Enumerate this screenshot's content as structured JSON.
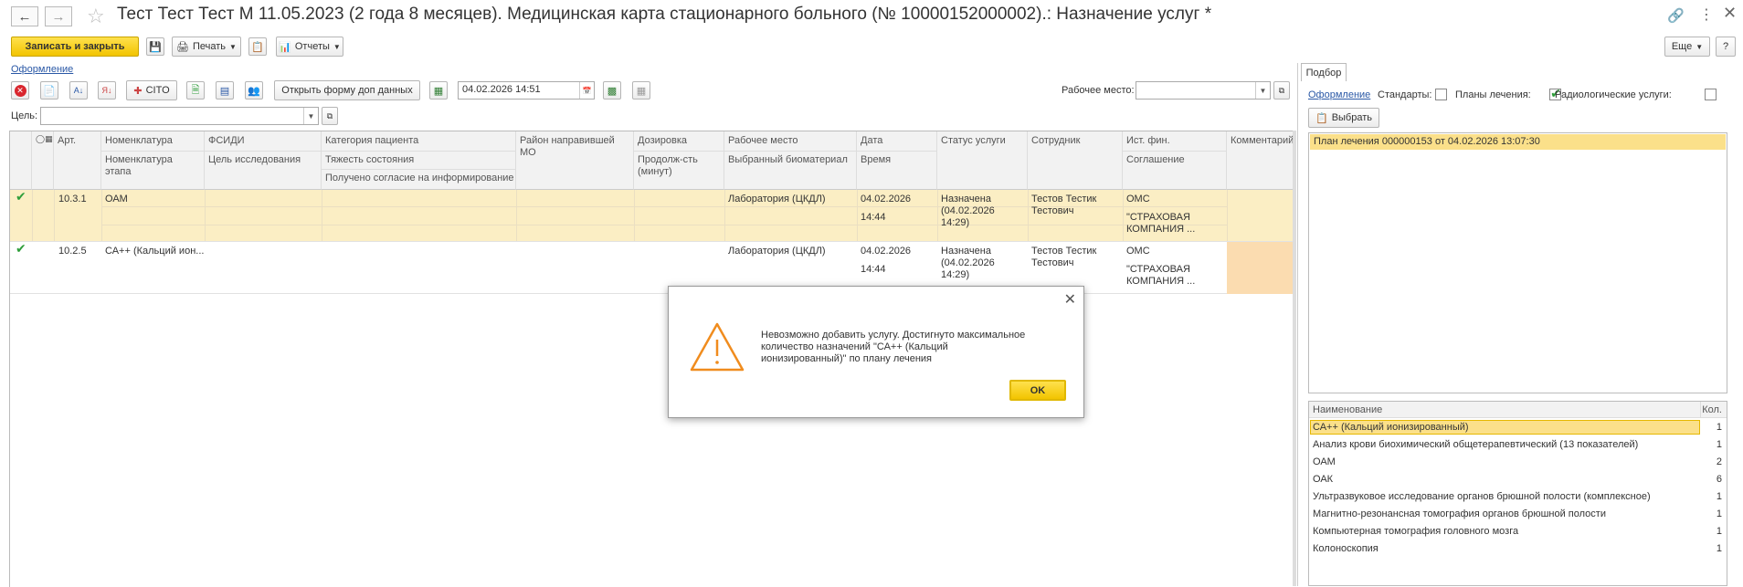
{
  "window": {
    "title": "Тест Тест Тест М 11.05.2023 (2 года 8 месяцев). Медицинская карта стационарного больного (№ 10000152000002).: Назначение услуг *"
  },
  "toolbar": {
    "save_close": "Записать и закрыть",
    "print": "Печать",
    "reports": "Отчеты",
    "more": "Еще",
    "help": "?"
  },
  "form_link": "Оформление",
  "toolbar2": {
    "cito": "CITO",
    "open_form": "Открыть форму доп данных",
    "datetime": "04.02.2026 14:51",
    "workplace_label": "Рабочее место:",
    "workplace_value": ""
  },
  "goal": {
    "label": "Цель:",
    "value": ""
  },
  "table": {
    "headers": {
      "art": "Арт.",
      "nomen": "Номенклатура",
      "nomen_stage": "Номенклатура этапа",
      "fsidi": "ФСИДИ",
      "research_goal": "Цель исследования",
      "patient_cat": "Категория пациента",
      "severity": "Тяжесть состояния",
      "consent": "Получено согласие на информирование",
      "district": "Район направившей МО",
      "dosage": "Дозировка",
      "duration": "Продолж-сть (минут)",
      "workplace": "Рабочее место",
      "biomaterial": "Выбранный биоматериал",
      "date": "Дата",
      "time": "Время",
      "status": "Статус услуги",
      "employee": "Сотрудник",
      "fin_source": "Ист. фин.",
      "agreement": "Соглашение",
      "comment": "Комментарий"
    },
    "rows": [
      {
        "art": "10.3.1",
        "nomen": "ОАМ",
        "workplace": "Лаборатория (ЦКДЛ)",
        "date": "04.02.2026",
        "time": "14:44",
        "status": "Назначена (04.02.2026 14:29)",
        "employee": "Тестов Тестик Тестович",
        "fin": "ОМС",
        "agreement": "\"СТРАХОВАЯ КОМПАНИЯ ..."
      },
      {
        "art": "10.2.5",
        "nomen": "СА++ (Кальций ион...",
        "workplace": "Лаборатория (ЦКДЛ)",
        "date": "04.02.2026",
        "time": "14:44",
        "status": "Назначена (04.02.2026 14:29)",
        "employee": "Тестов Тестик Тестович",
        "fin": "ОМС",
        "agreement": "\"СТРАХОВАЯ КОМПАНИЯ ..."
      }
    ]
  },
  "right_panel": {
    "tab": "Подбор",
    "form_link": "Оформление",
    "standards": "Стандарты:",
    "treatment_plans": "Планы лечения:",
    "radiology": "Радиологические услуги:",
    "select_button": "Выбрать",
    "plan_row": "План лечения 000000153 от 04.02.2026 13:07:30",
    "list_headers": {
      "name": "Наименование",
      "qty": "Кол."
    },
    "items": [
      {
        "name": "СА++ (Кальций ионизированный)",
        "qty": "1"
      },
      {
        "name": "Анализ крови биохимический общетерапевтический (13 показателей)",
        "qty": "1"
      },
      {
        "name": "ОАМ",
        "qty": "2"
      },
      {
        "name": "ОАК",
        "qty": "6"
      },
      {
        "name": "Ультразвуковое исследование органов брюшной полости (комплексное)",
        "qty": "1"
      },
      {
        "name": "Магнитно-резонансная томография органов брюшной полости",
        "qty": "1"
      },
      {
        "name": "Компьютерная томография головного мозга",
        "qty": "1"
      },
      {
        "name": "Колоноскопия",
        "qty": "1"
      }
    ]
  },
  "dialog": {
    "message": "Невозможно добавить услугу. Достигнуто максимальное количество назначений \"СА++ (Кальций ионизированный)\" по плану лечения",
    "ok": "OK"
  },
  "colors": {
    "accent_yellow": "#f5c800",
    "selection": "#fbeec4",
    "link": "#2a58a6",
    "check_green": "#2e9e3a",
    "warning": "#f08c1e"
  }
}
